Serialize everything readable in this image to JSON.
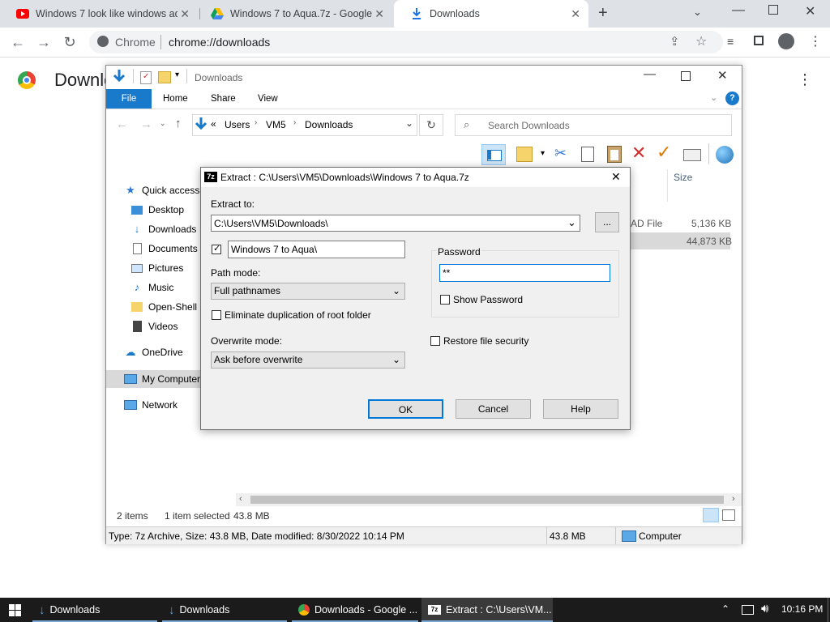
{
  "browser": {
    "tabs": [
      {
        "title": "Windows 7 look like windows aq",
        "icon": "youtube-icon"
      },
      {
        "title": "Windows 7 to Aqua.7z - Google D",
        "icon": "google-drive-icon"
      },
      {
        "title": "Downloads",
        "icon": "download-icon",
        "active": true
      }
    ],
    "new_tab_label": "+",
    "site_label": "Chrome",
    "url": "chrome://downloads",
    "page_heading": "Downloads"
  },
  "explorer": {
    "title": "Downloads",
    "ribbon_tabs": [
      "File",
      "Home",
      "Share",
      "View"
    ],
    "breadcrumb_prefix": "«",
    "breadcrumb": [
      "Users",
      "VM5",
      "Downloads"
    ],
    "search_placeholder": "Search Downloads",
    "nav_items": [
      {
        "label": "Quick access",
        "icon": "star-icon"
      },
      {
        "label": "Desktop",
        "icon": "desktop-icon"
      },
      {
        "label": "Downloads",
        "icon": "download-icon"
      },
      {
        "label": "Documents",
        "icon": "documents-icon"
      },
      {
        "label": "Pictures",
        "icon": "pictures-icon"
      },
      {
        "label": "Music",
        "icon": "music-icon"
      },
      {
        "label": "Open-Shell M",
        "icon": "folder-icon"
      },
      {
        "label": "Videos",
        "icon": "videos-icon"
      },
      {
        "label": "OneDrive",
        "icon": "cloud-icon"
      },
      {
        "label": "My Computer",
        "icon": "computer-icon",
        "selected": true
      },
      {
        "label": "Network",
        "icon": "network-icon"
      }
    ],
    "column_size_header": "Size",
    "file_rows": [
      {
        "type_fragment": "AD File",
        "size": "5,136 KB"
      },
      {
        "type_fragment": "",
        "size": "44,873 KB",
        "selected": true
      }
    ],
    "status": {
      "items_count": "2 items",
      "selection": "1 item selected",
      "selection_size": "43.8 MB"
    },
    "details_bar": {
      "info": "Type: 7z Archive, Size: 43.8 MB, Date modified: 8/30/2022 10:14 PM",
      "size": "43.8 MB",
      "location": "Computer"
    }
  },
  "dialog": {
    "title": "Extract : C:\\Users\\VM5\\Downloads\\Windows 7 to Aqua.7z",
    "extract_to_label": "Extract to:",
    "extract_to_value": "C:\\Users\\VM5\\Downloads\\",
    "browse_label": "...",
    "subfolder_checked": true,
    "subfolder_value": "Windows 7 to Aqua\\",
    "path_mode_label": "Path mode:",
    "path_mode_value": "Full pathnames",
    "eliminate_label": "Eliminate duplication of root folder",
    "overwrite_label": "Overwrite mode:",
    "overwrite_value": "Ask before overwrite",
    "password_group_label": "Password",
    "password_value": "**",
    "show_password_label": "Show Password",
    "restore_security_label": "Restore file security",
    "ok_label": "OK",
    "cancel_label": "Cancel",
    "help_label": "Help"
  },
  "taskbar": {
    "items": [
      {
        "label": "Downloads",
        "icon": "download-icon"
      },
      {
        "label": "Downloads",
        "icon": "download-icon"
      },
      {
        "label": "Downloads - Google ...",
        "icon": "chrome-icon"
      },
      {
        "label": "Extract : C:\\Users\\VM...",
        "icon": "7zip-icon",
        "active": true
      }
    ],
    "clock": "10:16 PM"
  },
  "colors": {
    "accent_blue": "#1979ca",
    "chrome_tabstrip": "#dee1e6",
    "taskbar": "#1b1b1b",
    "red_x": "#d32f2f"
  }
}
